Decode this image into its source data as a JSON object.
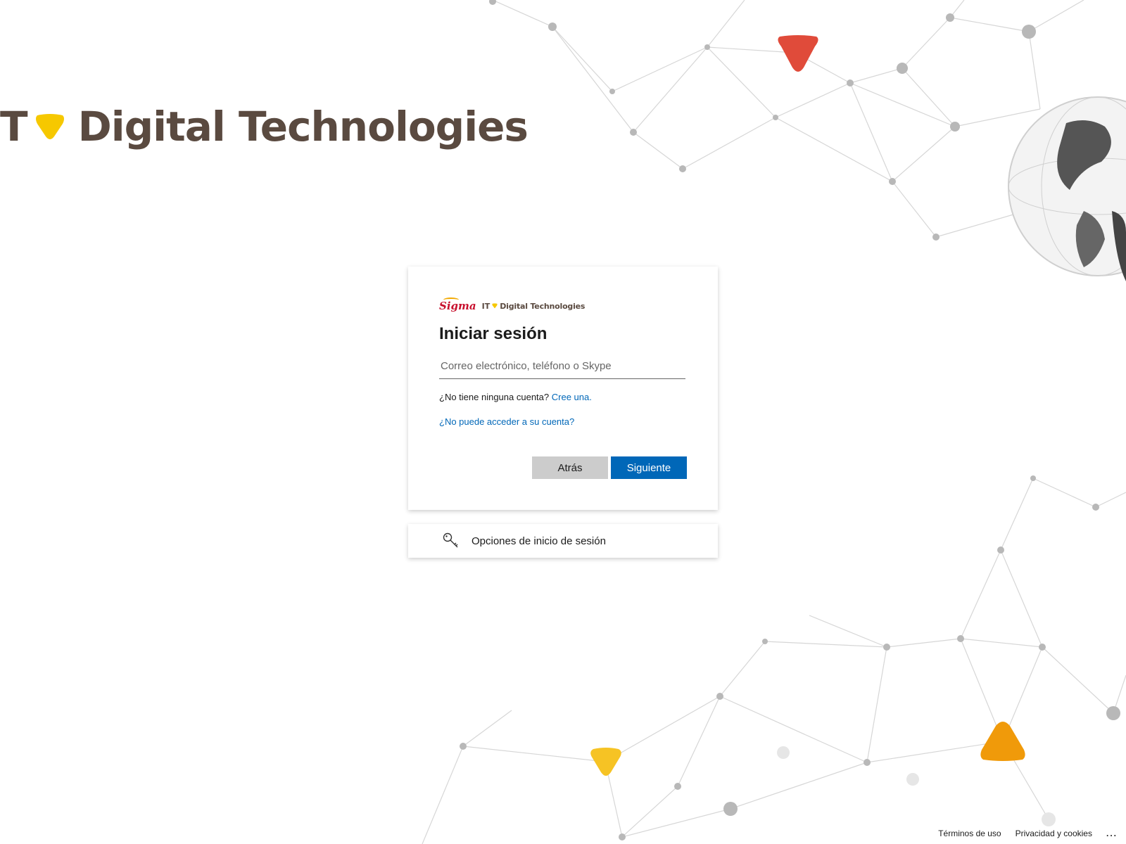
{
  "background": {
    "hero_logo": {
      "it": "T",
      "text": "Digital Technologies"
    },
    "accent_colors": {
      "red": "#e04b3a",
      "yellow": "#f6c324",
      "orange": "#f09a0a",
      "brand_brown": "#5a4a40"
    }
  },
  "card": {
    "brand": {
      "sigma": "Sigma",
      "it": "IT",
      "name": "Digital Technologies"
    },
    "title": "Iniciar sesión",
    "email_placeholder": "Correo electrónico, teléfono o Skype",
    "email_value": "",
    "no_account_text": "¿No tiene ninguna cuenta?",
    "create_link": "Cree una.",
    "cant_access_link": "¿No puede acceder a su cuenta?",
    "back_button": "Atrás",
    "next_button": "Siguiente"
  },
  "signin_options": {
    "label": "Opciones de inicio de sesión",
    "icon": "key-icon"
  },
  "footer": {
    "terms": "Términos de uso",
    "privacy": "Privacidad y cookies",
    "more": "..."
  },
  "colors": {
    "primary": "#0067b8",
    "secondary_button": "#cccccc",
    "link": "#0067b8"
  }
}
